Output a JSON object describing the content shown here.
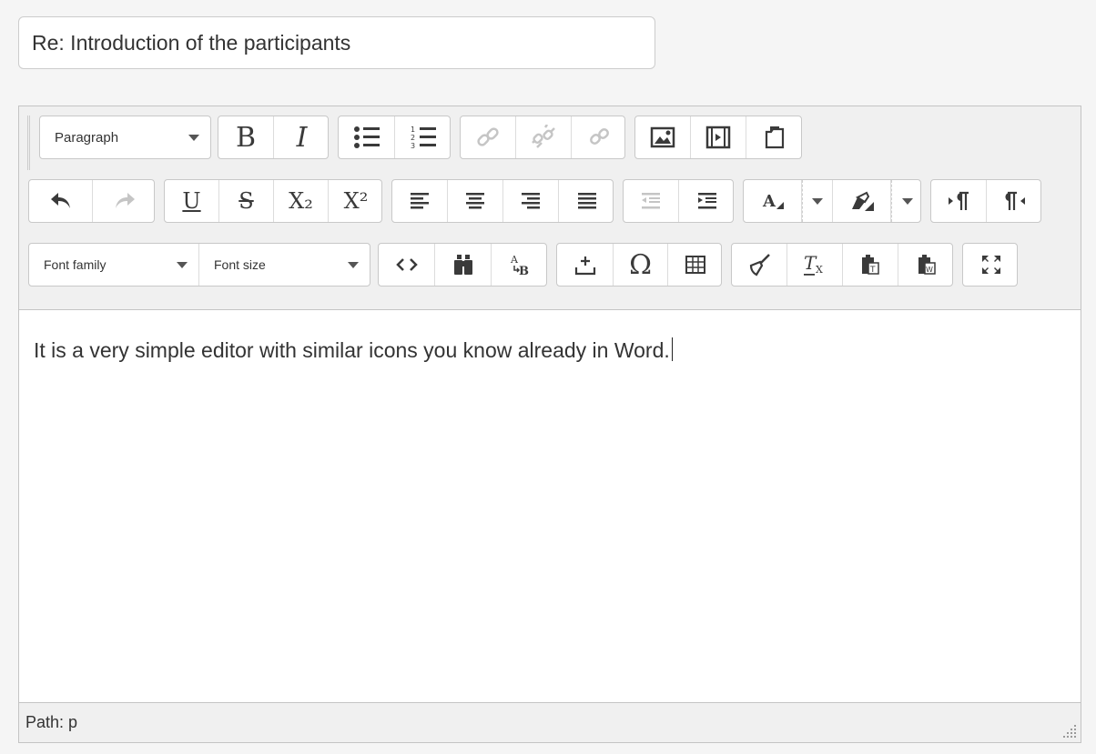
{
  "subject": {
    "value": "Re: Introduction of the participants"
  },
  "toolbar": {
    "format_select": "Paragraph",
    "font_family_select": "Font family",
    "font_size_select": "Font size",
    "bold": "B",
    "italic": "I",
    "underline": "U",
    "strikethrough": "S",
    "subscript": "X₂",
    "superscript": "X²",
    "omega": "Ω"
  },
  "content": {
    "text": "It is a very simple editor with similar icons you know already in Word."
  },
  "status": {
    "path": "Path: p"
  },
  "icons": {
    "text_color_icon": "text-color-icon",
    "bg_color_icon": "background-color-icon",
    "fullscreen_icon": "fullscreen-icon"
  }
}
